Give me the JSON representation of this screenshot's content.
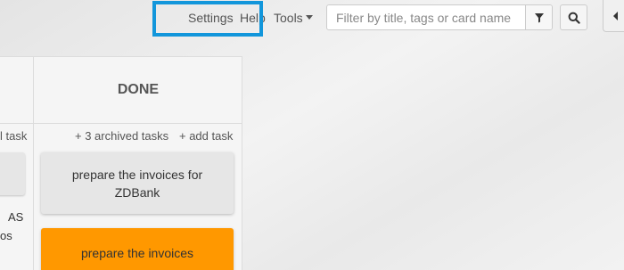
{
  "nav": {
    "settings": "Settings",
    "help": "Help",
    "tools": "Tools"
  },
  "search": {
    "placeholder": "Filter by title, tags or card name"
  },
  "icons": {
    "filter": "filter-icon",
    "search": "search-icon",
    "toggle": "chevron-left-icon"
  },
  "board": {
    "previous_column": {
      "action_fragment": "l task",
      "card_text_fragments": [
        "AS",
        "os"
      ]
    },
    "done_column": {
      "title": "DONE",
      "archived_label": "+ 3 archived tasks",
      "add_task_label": "+ add task",
      "cards": [
        {
          "text": "prepare the invoices for ZDBank",
          "color": "#e6e6e6"
        },
        {
          "text": "prepare the invoices",
          "color": "#ff9800"
        }
      ]
    }
  },
  "colors": {
    "highlight": "#1296db",
    "card_orange": "#ff9800",
    "card_grey": "#e6e6e6"
  }
}
